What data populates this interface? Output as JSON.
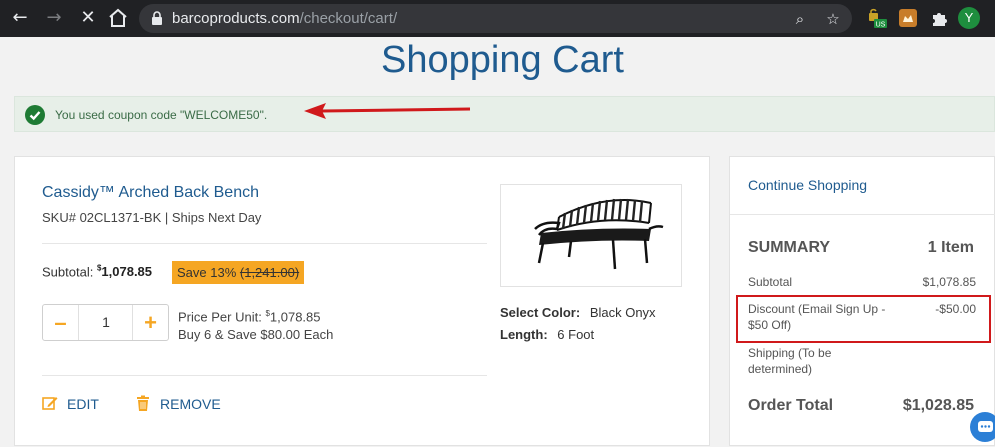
{
  "browser": {
    "url_domain": "barcoproducts.com",
    "url_path": "/checkout/cart/",
    "profile_initial": "Y",
    "ext_badge": "US"
  },
  "page": {
    "title": "Shopping Cart",
    "coupon_message": "You used coupon code \"WELCOME50\"."
  },
  "item": {
    "name": "Cassidy™ Arched Back Bench",
    "sku_line": "SKU# 02CL1371-BK | Ships Next Day",
    "subtotal_label": "Subtotal:",
    "subtotal_currency": "$",
    "subtotal_value": "1,078.85",
    "save_text": "Save 13%",
    "original_price": "(1,241.00)",
    "quantity": "1",
    "price_per_unit_label": "Price Per Unit:",
    "price_per_unit_currency": "$",
    "price_per_unit_value": "1,078.85",
    "bulk_offer": "Buy 6 & Save $80.00 Each",
    "color_label": "Select Color:",
    "color_value": "Black Onyx",
    "length_label": "Length:",
    "length_value": "6 Foot",
    "edit_label": "EDIT",
    "remove_label": "REMOVE"
  },
  "summary": {
    "continue_label": "Continue Shopping",
    "heading": "SUMMARY",
    "item_count": "1 Item",
    "subtotal_label": "Subtotal",
    "subtotal_value": "$1,078.85",
    "discount_label": "Discount (Email Sign Up - $50 Off)",
    "discount_value": "-$50.00",
    "shipping_label": "Shipping (To be determined)",
    "total_label": "Order Total",
    "total_value": "$1,028.85"
  },
  "colors": {
    "brand_blue": "#1f5b8f",
    "accent_orange": "#f5a623",
    "success_green": "#1e7b34",
    "annotation_red": "#d0191b"
  }
}
